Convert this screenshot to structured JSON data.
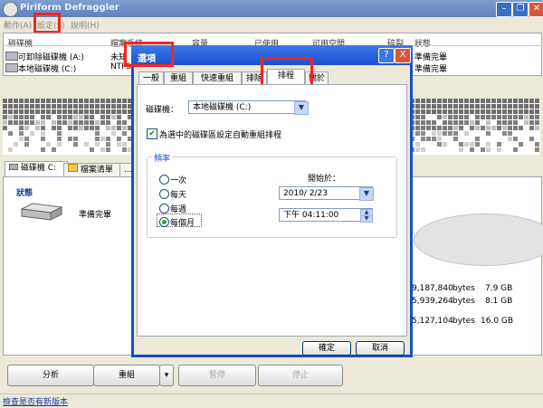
{
  "window": {
    "title": "Piriform Defraggler"
  },
  "menu": [
    "動作(A)",
    "設定(S)",
    "說明(H)"
  ],
  "drive_list": {
    "columns": [
      "磁碟機",
      "檔案系統",
      "容量",
      "已使用",
      "可用空間",
      "碎裂",
      "狀態"
    ],
    "rows": [
      {
        "name": "可卸除磁碟機 (A:)",
        "fs": "未知",
        "status": "準備完畢"
      },
      {
        "name": "本地磁碟機 (C:)",
        "fs": "NTFS",
        "status": "準備完畢"
      }
    ]
  },
  "tabs": [
    "磁碟機 C:",
    "檔案清單",
    "..."
  ],
  "status": {
    "heading": "狀態",
    "text": "準備完畢"
  },
  "stats": [
    {
      "bytes": "9,187,840",
      "unit": "bytes",
      "size": "7.9 GB"
    },
    {
      "bytes": "5,939,264",
      "unit": "bytes",
      "size": "8.1 GB"
    },
    {
      "bytes": "5,127,104",
      "unit": "bytes",
      "size": "16.0 GB"
    }
  ],
  "buttons": {
    "analyze": "分析",
    "defrag": "重組",
    "pause": "暫停",
    "stop": "停止"
  },
  "statusbar": {
    "link": "檢查是否有新版本"
  },
  "dialog": {
    "title": "選項",
    "tabs": [
      "一般",
      "重組",
      "快速重組",
      "排除",
      "排程",
      "關於"
    ],
    "drive_label": "磁碟機：",
    "drive_value": "本地磁碟機 (C:)",
    "auto_checkbox": "為選中的磁碟區設定自動重組排程",
    "frequency": {
      "title": "頻率",
      "options": [
        "一次",
        "每天",
        "每週",
        "每個月"
      ],
      "selected": "每個月"
    },
    "start_label": "開始於：",
    "date": "2010/  2/23",
    "time": "下午 04:11:00",
    "ok": "確定",
    "cancel": "取消",
    "help": "?",
    "close": "X"
  },
  "colors": {
    "highlight": "#ff2020",
    "dialog_border": "#1b4dc4",
    "titlebar": "#5f83bd"
  }
}
